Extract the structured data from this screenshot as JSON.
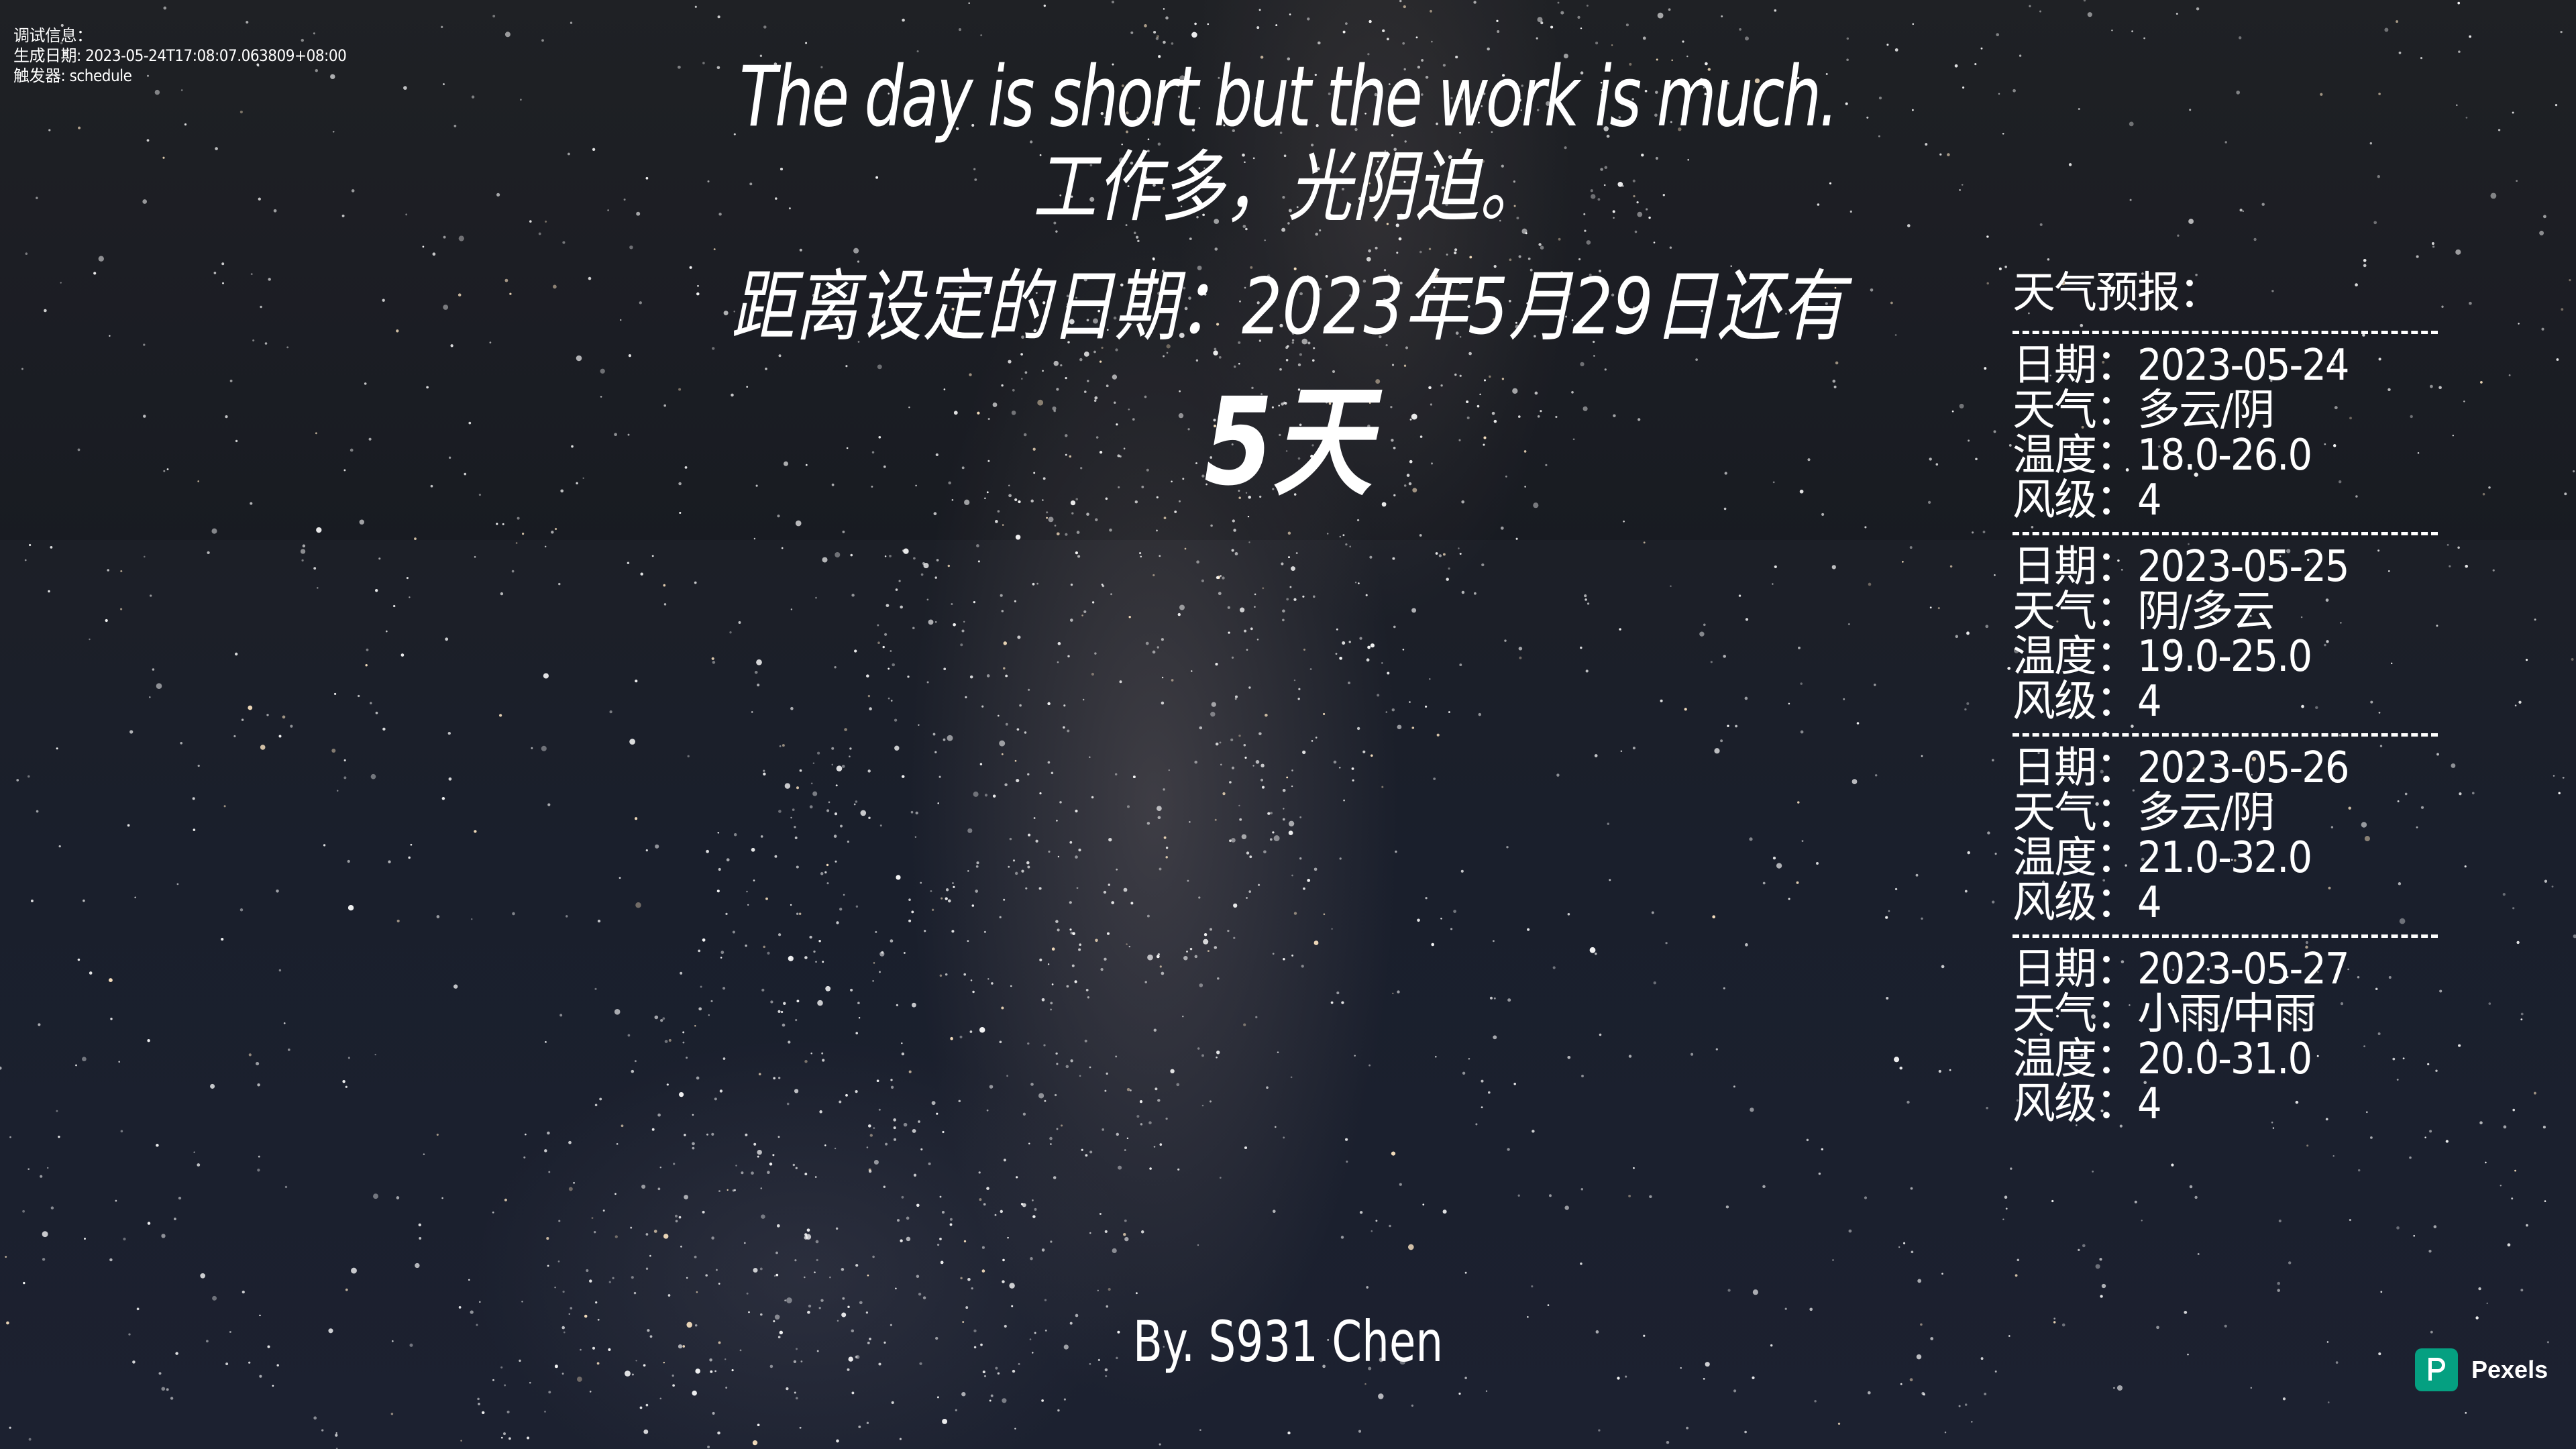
{
  "debug": {
    "heading": "调试信息：",
    "generated": "生成日期: 2023-05-24T17:08:07.063809+08:00",
    "trigger": "触发器: schedule"
  },
  "quote": {
    "english": "The day is short but the work is much.",
    "chinese": "工作多，光阴迫。"
  },
  "countdown": {
    "text": "距离设定的日期：2023年5月29日还有",
    "days": "5天"
  },
  "author": "By. S931 Chen",
  "weather": {
    "title": "天气预报：",
    "days": [
      {
        "date": "日期：2023-05-24",
        "weather": "天气：多云/阴",
        "temp": "温度：18.0-26.0",
        "wind": "风级：4"
      },
      {
        "date": "日期：2023-05-25",
        "weather": "天气：阴/多云",
        "temp": "温度：19.0-25.0",
        "wind": "风级：4"
      },
      {
        "date": "日期：2023-05-26",
        "weather": "天气：多云/阴",
        "temp": "温度：21.0-32.0",
        "wind": "风级：4"
      },
      {
        "date": "日期：2023-05-27",
        "weather": "天气：小雨/中雨",
        "temp": "温度：20.0-31.0",
        "wind": "风级：4"
      }
    ]
  },
  "watermark": {
    "label": "Pexels",
    "icon": "pexels-logo-icon",
    "color": "#05a081"
  }
}
